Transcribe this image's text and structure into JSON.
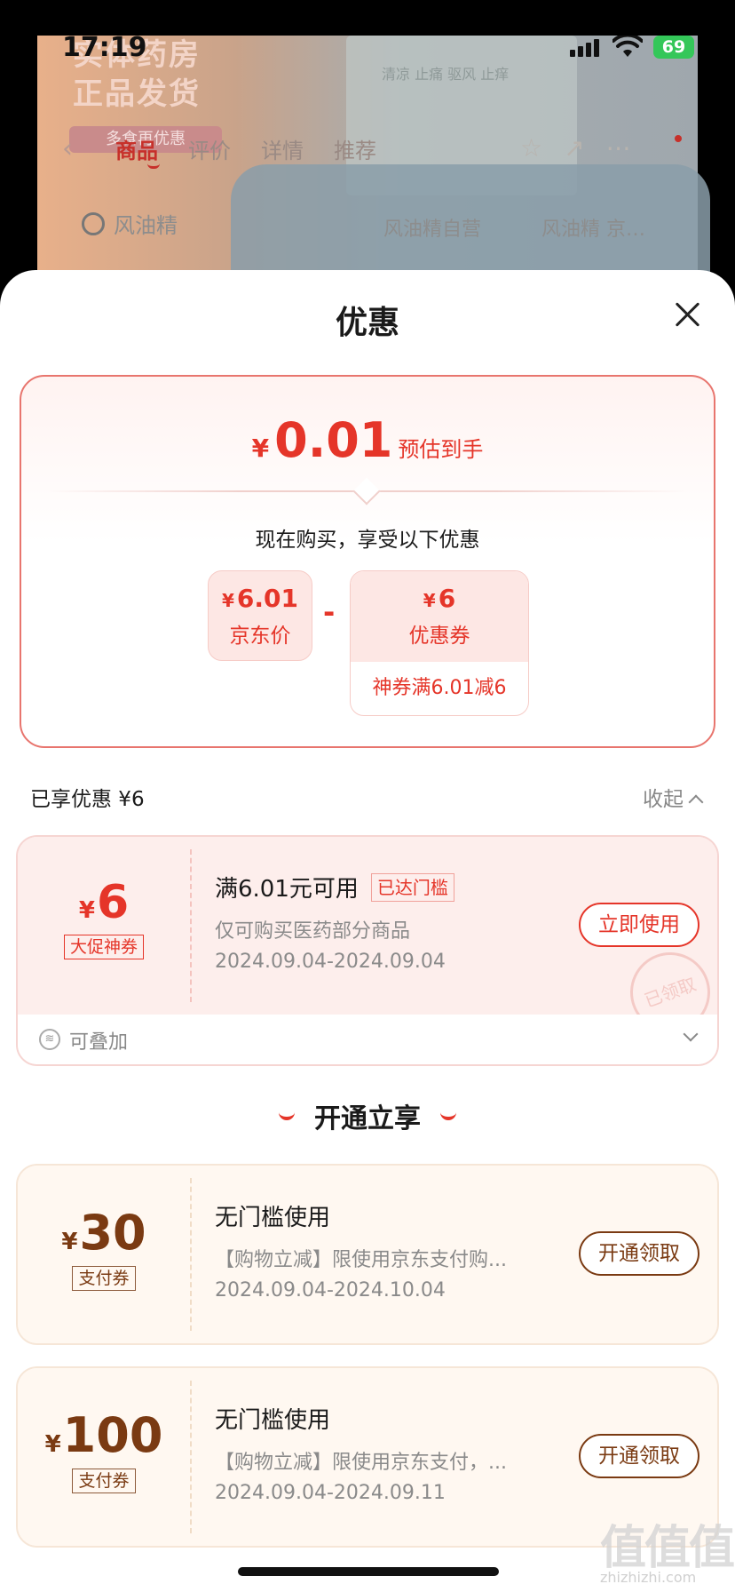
{
  "status_bar": {
    "time": "17:19",
    "battery": "69"
  },
  "background": {
    "banner_line1": "实体药房",
    "banner_line2": "正品发货",
    "banner_badge": "多食再优惠",
    "product_text": "清凉 止痛 驱风 止痒",
    "back_icon": "chevron-left-icon",
    "tabs": [
      {
        "label": "商品",
        "active": true
      },
      {
        "label": "评价",
        "active": false
      },
      {
        "label": "详情",
        "active": false
      },
      {
        "label": "推荐",
        "active": false
      }
    ],
    "search_text": "风油精",
    "suggest_1": "风油精自营",
    "suggest_2": "风油精 京…"
  },
  "sheet": {
    "title": "优惠",
    "summary": {
      "yen": "¥",
      "final_price": "0.01",
      "final_label": "预估到手",
      "buy_now_text": "现在购买，享受以下优惠",
      "jd_price_yen": "¥",
      "jd_price": "6.01",
      "jd_price_label": "京东价",
      "minus": "-",
      "coupon_yen": "¥",
      "coupon_value": "6",
      "coupon_label": "优惠券",
      "coupon_detail": "神券满6.01减6"
    },
    "applied_text": "已享优惠 ¥6",
    "collapse_label": "收起",
    "coupons": [
      {
        "yen": "¥",
        "amount": "6",
        "tag": "大促神券",
        "title": "满6.01元可用",
        "threshold_tag": "已达门槛",
        "desc": "仅可购买医药部分商品",
        "date": "2024.09.04-2024.09.04",
        "button": "立即使用",
        "stamp": "已领取",
        "stack_icon": "stack-icon",
        "stack_label": "可叠加"
      }
    ],
    "section_title": "开通立享",
    "open_coupons": [
      {
        "yen": "¥",
        "amount": "30",
        "tag": "支付券",
        "title": "无门槛使用",
        "desc": "【购物立减】限使用京东支付购...",
        "date": "2024.09.04-2024.10.04",
        "button": "开通领取"
      },
      {
        "yen": "¥",
        "amount": "100",
        "tag": "支付券",
        "title": "无门槛使用",
        "desc": "【购物立减】限使用京东支付，...",
        "date": "2024.09.04-2024.09.11",
        "button": "开通领取"
      }
    ]
  },
  "watermark": {
    "main": "值值值",
    "sub": "zhizhizhi.com"
  },
  "colors": {
    "accent_red": "#e53529",
    "brown": "#7a3a12",
    "battery_green": "#34c759"
  }
}
